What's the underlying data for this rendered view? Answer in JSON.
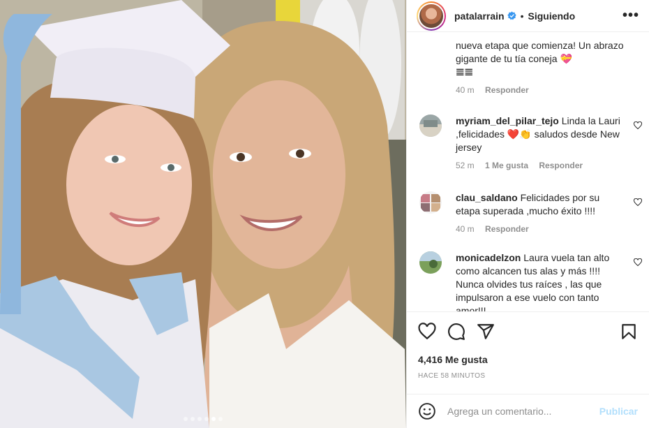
{
  "post": {
    "username": "patalarrain",
    "separator": "•",
    "follow_state": "Siguiendo",
    "more_label": "•••",
    "carousel_dots": 6,
    "active_dot": 5
  },
  "comments": [
    {
      "user": "",
      "text": "nueva etapa que comienza! Un abrazo gigante de tu tía coneja 💝",
      "extra_line": "𝌆𝌆",
      "time": "40 m",
      "likes": "",
      "reply": "Responder"
    },
    {
      "user": "myriam_del_pilar_tejo",
      "text": "Linda la Lauri ,felicidades ❤️👏 saludos desde New jersey",
      "time": "52 m",
      "likes": "1 Me gusta",
      "reply": "Responder"
    },
    {
      "user": "clau_saldano",
      "text": "Felicidades por su etapa superada ,mucho éxito !!!!",
      "time": "40 m",
      "likes": "",
      "reply": "Responder"
    },
    {
      "user": "monicadelzon",
      "text": "Laura vuela tan alto como alcancen tus alas y más !!!! Nunca olvides tus raíces , las que impulsaron a ese vuelo con tanto amor!!!",
      "time": "",
      "likes": "",
      "reply": ""
    }
  ],
  "actions": {
    "likes": "4,416 Me gusta",
    "time_ago": "HACE 58 MINUTOS"
  },
  "composer": {
    "placeholder": "Agrega un comentario...",
    "publish": "Publicar"
  },
  "colors": {
    "verified": "#3897f0",
    "publish_disabled": "#b2dffc",
    "meta_gray": "#8e8e8e"
  }
}
